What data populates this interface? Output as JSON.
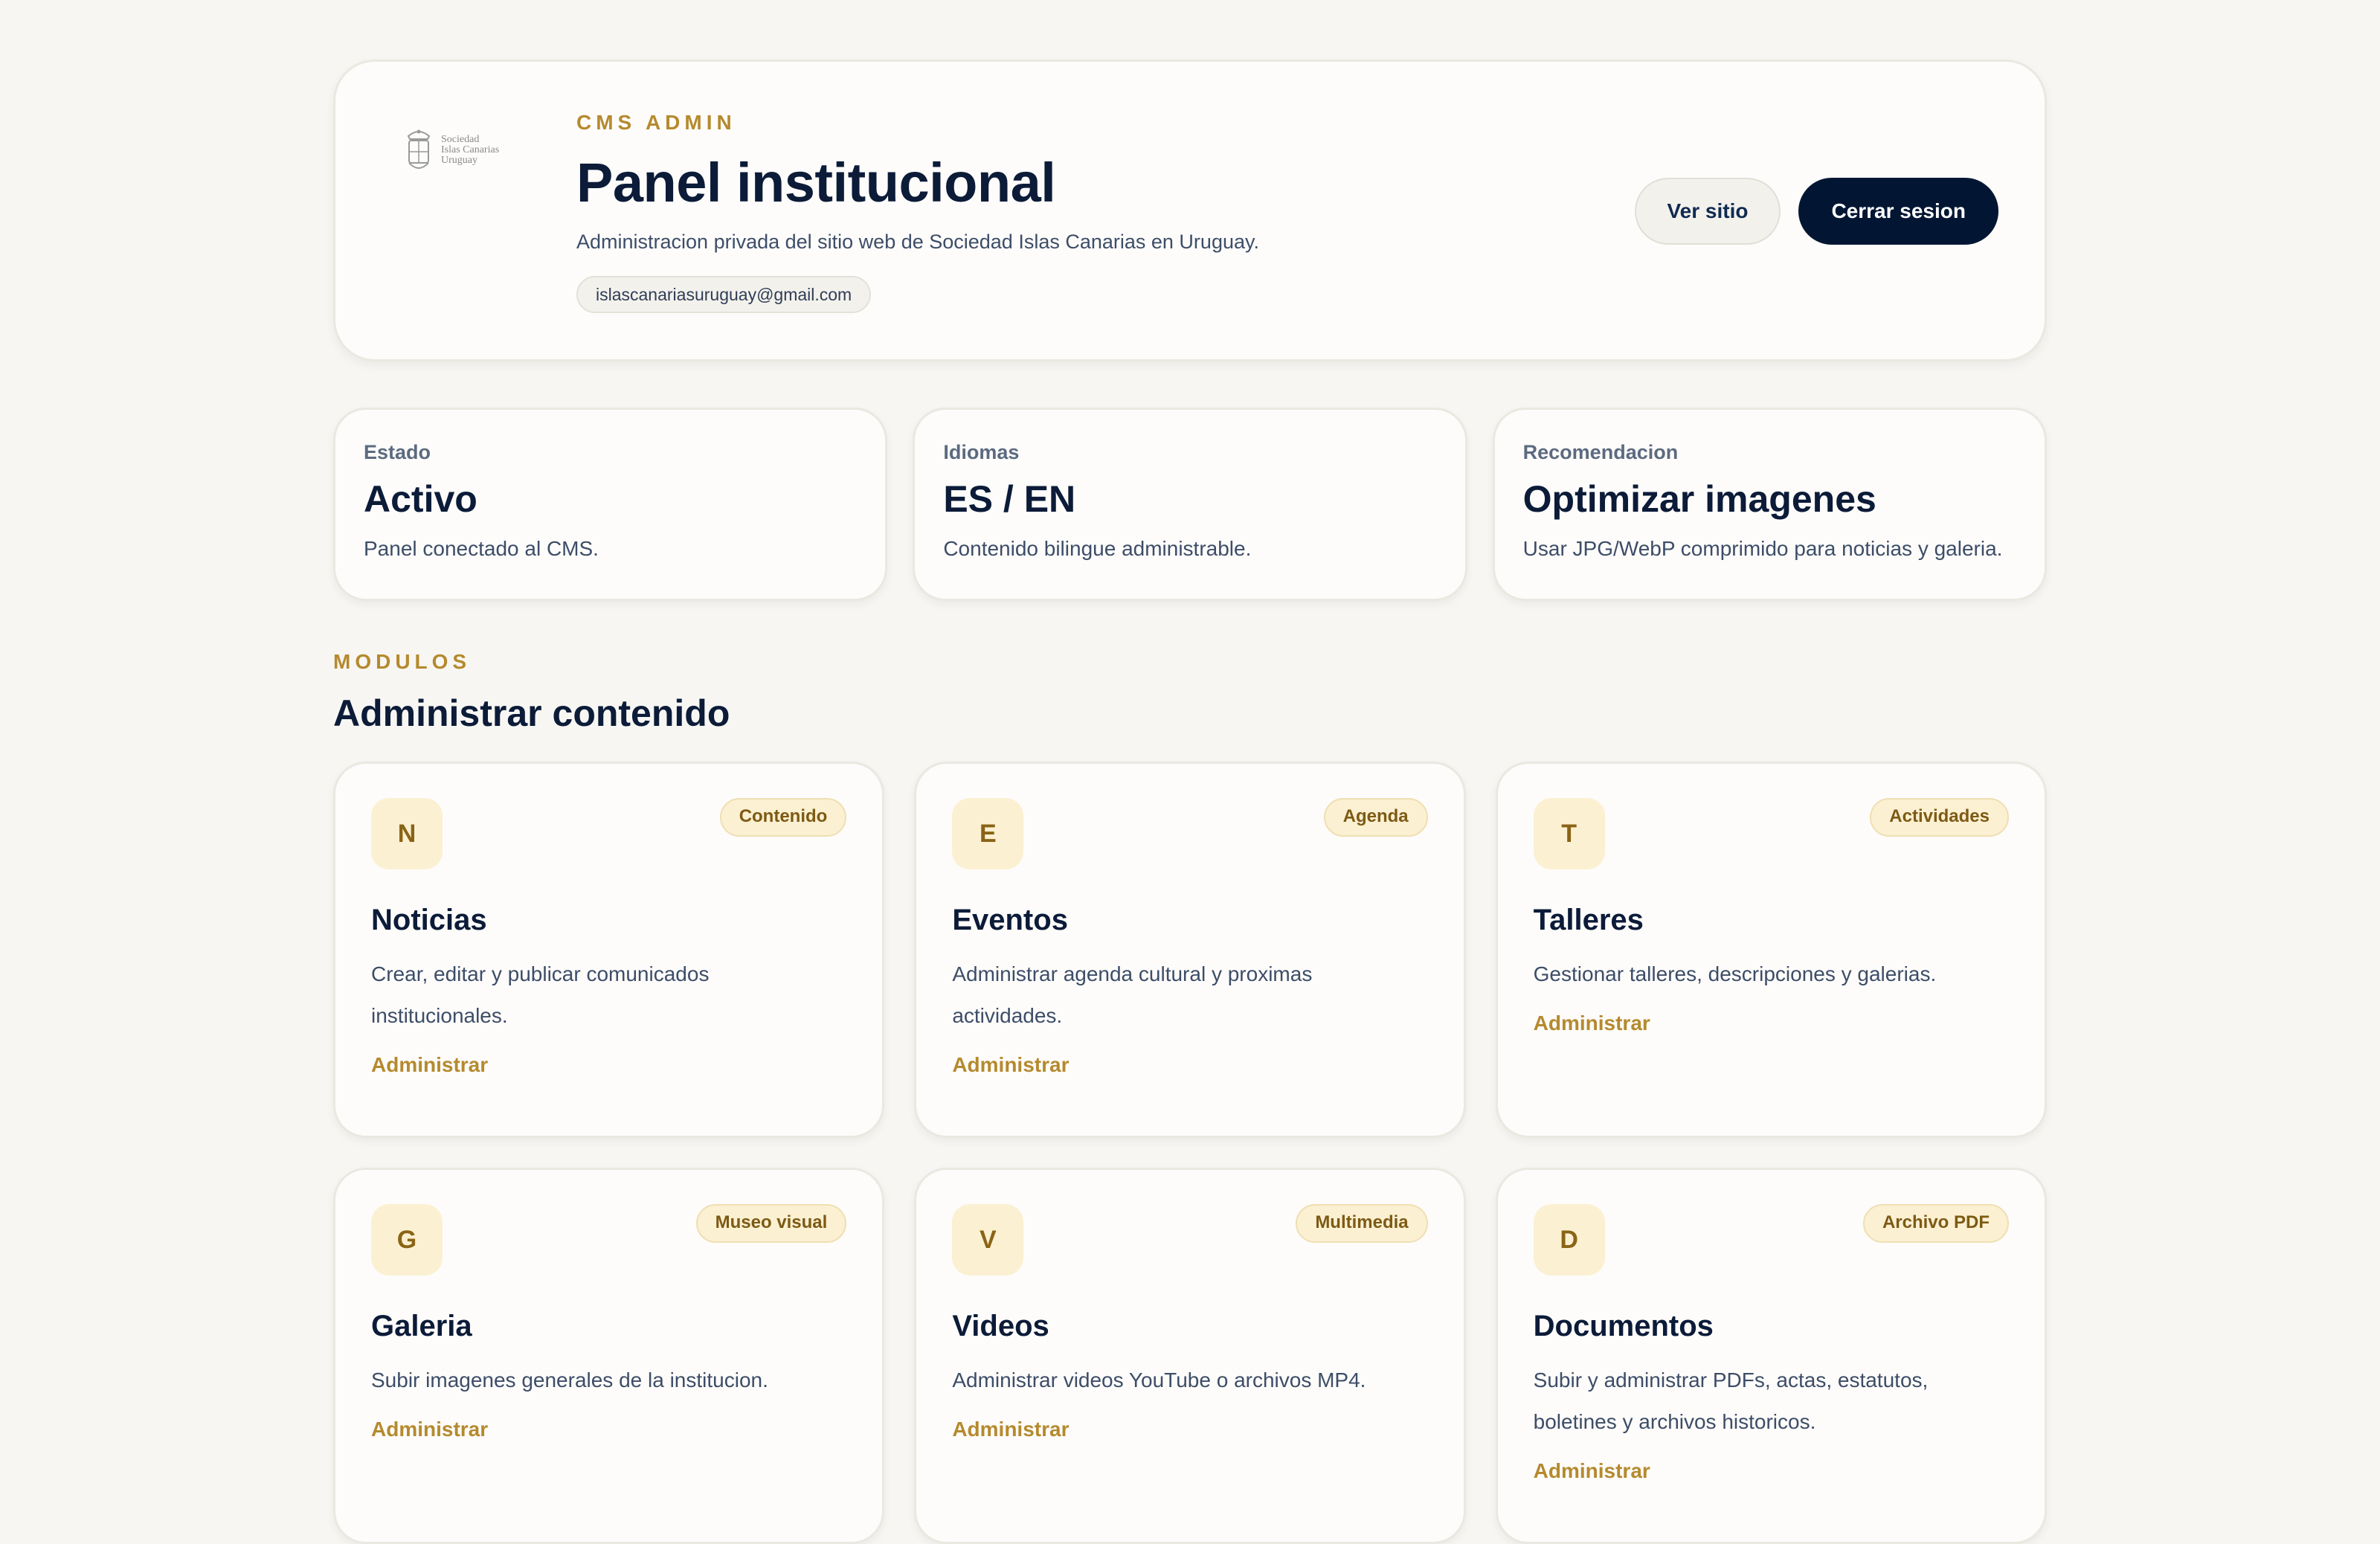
{
  "header": {
    "logo_text": [
      "Sociedad",
      "Islas Canarias",
      "Uruguay"
    ],
    "eyebrow": "CMS ADMIN",
    "title": "Panel institucional",
    "subtitle": "Administracion privada del sitio web de Sociedad Islas Canarias en Uruguay.",
    "email": "islascanariasuruguay@gmail.com",
    "view_site_label": "Ver sitio",
    "logout_label": "Cerrar sesion"
  },
  "stats": [
    {
      "label": "Estado",
      "value": "Activo",
      "desc": "Panel conectado al CMS."
    },
    {
      "label": "Idiomas",
      "value": "ES / EN",
      "desc": "Contenido bilingue administrable."
    },
    {
      "label": "Recomendacion",
      "value": "Optimizar imagenes",
      "desc": "Usar JPG/WebP comprimido para noticias y galeria."
    }
  ],
  "modules_section": {
    "eyebrow": "MODULOS",
    "title": "Administrar contenido"
  },
  "modules": [
    {
      "letter": "N",
      "badge": "Contenido",
      "title": "Noticias",
      "desc": "Crear, editar y publicar comunicados institucionales.",
      "link": "Administrar"
    },
    {
      "letter": "E",
      "badge": "Agenda",
      "title": "Eventos",
      "desc": "Administrar agenda cultural y proximas actividades.",
      "link": "Administrar"
    },
    {
      "letter": "T",
      "badge": "Actividades",
      "title": "Talleres",
      "desc": "Gestionar talleres, descripciones y galerias.",
      "link": "Administrar"
    },
    {
      "letter": "G",
      "badge": "Museo visual",
      "title": "Galeria",
      "desc": "Subir imagenes generales de la institucion.",
      "link": "Administrar"
    },
    {
      "letter": "V",
      "badge": "Multimedia",
      "title": "Videos",
      "desc": "Administrar videos YouTube o archivos MP4.",
      "link": "Administrar"
    },
    {
      "letter": "D",
      "badge": "Archivo PDF",
      "title": "Documentos",
      "desc": "Subir y administrar PDFs, actas, estatutos, boletines y archivos historicos.",
      "link": "Administrar"
    }
  ],
  "colors": {
    "accent": "#b58a2e",
    "navy": "#021633",
    "badge_bg": "#fbf0d2",
    "background": "#f7f6f3"
  },
  "icons": {
    "logo": "crest-icon"
  }
}
